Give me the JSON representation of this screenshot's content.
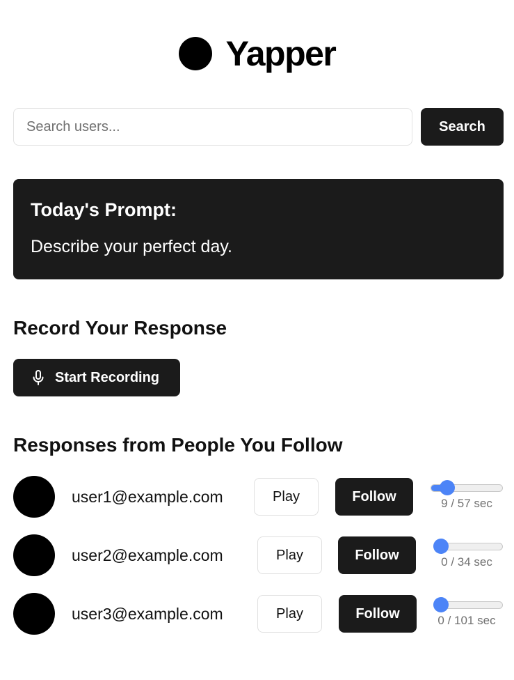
{
  "app": {
    "title": "Yapper"
  },
  "search": {
    "placeholder": "Search users...",
    "value": "",
    "button_label": "Search"
  },
  "prompt": {
    "title": "Today's Prompt:",
    "text": "Describe your perfect day."
  },
  "record": {
    "heading": "Record Your Response",
    "button_label": "Start Recording",
    "icon": "microphone-icon"
  },
  "responses": {
    "heading": "Responses from People You Follow",
    "items": [
      {
        "email": "user1@example.com",
        "play_label": "Play",
        "follow_label": "Follow",
        "current_sec": 9,
        "total_sec": 57,
        "time_text": "9 / 57 sec"
      },
      {
        "email": "user2@example.com",
        "play_label": "Play",
        "follow_label": "Follow",
        "current_sec": 0,
        "total_sec": 34,
        "time_text": "0 / 34 sec"
      },
      {
        "email": "user3@example.com",
        "play_label": "Play",
        "follow_label": "Follow",
        "current_sec": 0,
        "total_sec": 101,
        "time_text": "0 / 101 sec"
      }
    ]
  },
  "colors": {
    "dark": "#1b1b1b",
    "accent": "#4c84f7",
    "muted_text": "#707070"
  }
}
